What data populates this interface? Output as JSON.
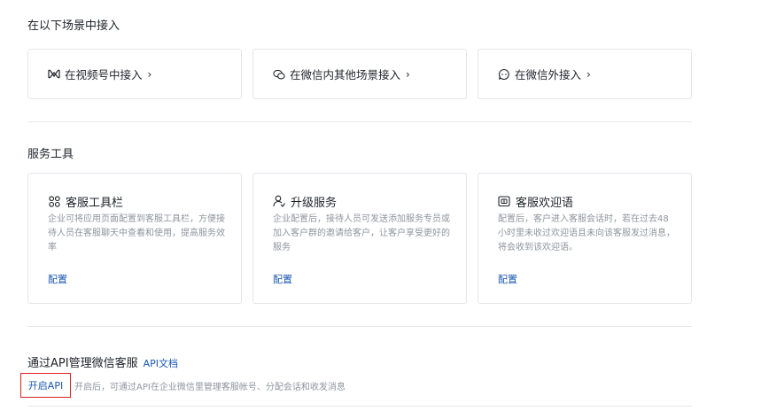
{
  "sections": {
    "scenes_title": "在以下场景中接入",
    "tools_title": "服务工具"
  },
  "entries": [
    {
      "icon": "channels-icon",
      "label": "在视频号中接入",
      "chevron": "›"
    },
    {
      "icon": "wechat-scenes-icon",
      "label": "在微信内其他场景接入",
      "chevron": "›"
    },
    {
      "icon": "chat-bubble-icon",
      "label": "在微信外接入",
      "chevron": "›"
    }
  ],
  "tools": [
    {
      "icon": "grid-icon",
      "title": "客服工具栏",
      "desc": "企业可将应用页面配置到客服工具栏，方便接待人员在客服聊天中查看和使用，提高服务效率",
      "link": "配置"
    },
    {
      "icon": "user-upgrade-icon",
      "title": "升级服务",
      "desc": "企业配置后，接待人员可发送添加服务专员或加入客户群的邀请给客户，让客户享受更好的服务",
      "link": "配置"
    },
    {
      "icon": "welcome-message-icon",
      "title": "客服欢迎语",
      "desc": "配置后，客户进入客服会话时，若在过去48小时里未收过欢迎语且未向该客服发过消息，将会收到该欢迎语。",
      "link": "配置"
    }
  ],
  "api": {
    "title": "通过API管理微信客服",
    "doc_link": "API文档",
    "open_button": "开启API",
    "hint": "开启后，可通过API在企业微信里管理客服帐号、分配会话和收发消息"
  },
  "colors": {
    "link": "#1a57b3",
    "muted": "#8f959e",
    "border": "#e4e6ea",
    "highlight": "#e02020"
  }
}
